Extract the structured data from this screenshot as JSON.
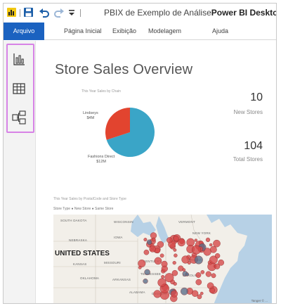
{
  "window": {
    "title_doc": "PBIX de Exemplo de Análise",
    "title_app": "Power BI Desktop"
  },
  "ribbon": {
    "tabs": [
      "Arquivo",
      "Página Inicial",
      "Exibição",
      "Modelagem",
      "Ajuda"
    ],
    "active_tab": "Arquivo",
    "accent_color": "#1b62c0"
  },
  "left_nav": {
    "items": [
      {
        "name": "report-view",
        "icon": "bar-chart-icon"
      },
      {
        "name": "data-view",
        "icon": "table-grid-icon"
      },
      {
        "name": "model-view",
        "icon": "relationships-icon"
      }
    ],
    "highlight_color": "#d783e6"
  },
  "report": {
    "title": "Store Sales Overview",
    "pie": {
      "title": "This Year Sales by Chain",
      "slices": [
        {
          "label": "Lindseys",
          "sublabel": "$4M",
          "share": 0.3,
          "color": "#e2442f"
        },
        {
          "label": "Fashions Direct",
          "sublabel": "$12M",
          "share": 0.7,
          "color": "#3aa5c7"
        }
      ],
      "labels": {
        "lindseys": "Lindseys\n$4M",
        "fashions": "Fashions Direct\n$12M"
      }
    },
    "cards": {
      "new_stores": {
        "value": "10",
        "label": "New Stores"
      },
      "total_stores": {
        "value": "104",
        "label": "Total Stores"
      }
    },
    "map": {
      "title": "This Year Sales by PostalCode and Store Type",
      "legend": "Store Type ● New Store ●   Same Store",
      "region_labels": {
        "south_dakota": "SOUTH DAKOTA",
        "wisconsin": "WISCONSIN",
        "vermont": "VERMONT",
        "nebraska": "NEBRASKA",
        "iowa": "IOWA",
        "new_york": "NEW YORK",
        "united_states": "UNITED STATES",
        "kansas": "KANSAS",
        "missouri": "MISSOURI",
        "kentucky": "KENTUCKY",
        "virginia": "VIRGINIA",
        "oklahoma": "OKLAHOMA",
        "arkansas": "ARKANSAS",
        "tennessee": "TENNESSEE",
        "carolina": "CAROLINA",
        "alabama": "ALABAMA",
        "georgia": "GEORGIA"
      },
      "credit": "Tanger © ...",
      "land_color": "#f2efe9",
      "water_color": "#b7d1e6",
      "bubble_color": "#d64a4a"
    }
  }
}
